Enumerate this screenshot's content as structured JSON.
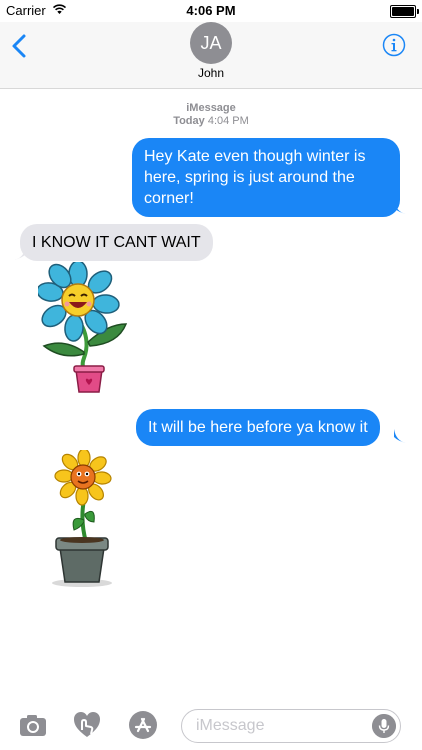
{
  "status": {
    "carrier": "Carrier",
    "time": "4:06 PM"
  },
  "header": {
    "initials": "JA",
    "name": "John"
  },
  "thread": {
    "service": "iMessage",
    "day": "Today",
    "time": "4:04 PM",
    "messages": [
      {
        "from": "me",
        "text": "Hey Kate even though winter is here, spring is just around the corner!"
      },
      {
        "from": "them",
        "text": "I KNOW IT CANT WAIT"
      },
      {
        "from": "me",
        "text": "It will be here before ya know it"
      }
    ]
  },
  "composer": {
    "placeholder": "iMessage",
    "value": ""
  },
  "colors": {
    "accent": "#1a86f6",
    "incoming": "#e5e5ea",
    "avatar": "#8e8e93"
  }
}
